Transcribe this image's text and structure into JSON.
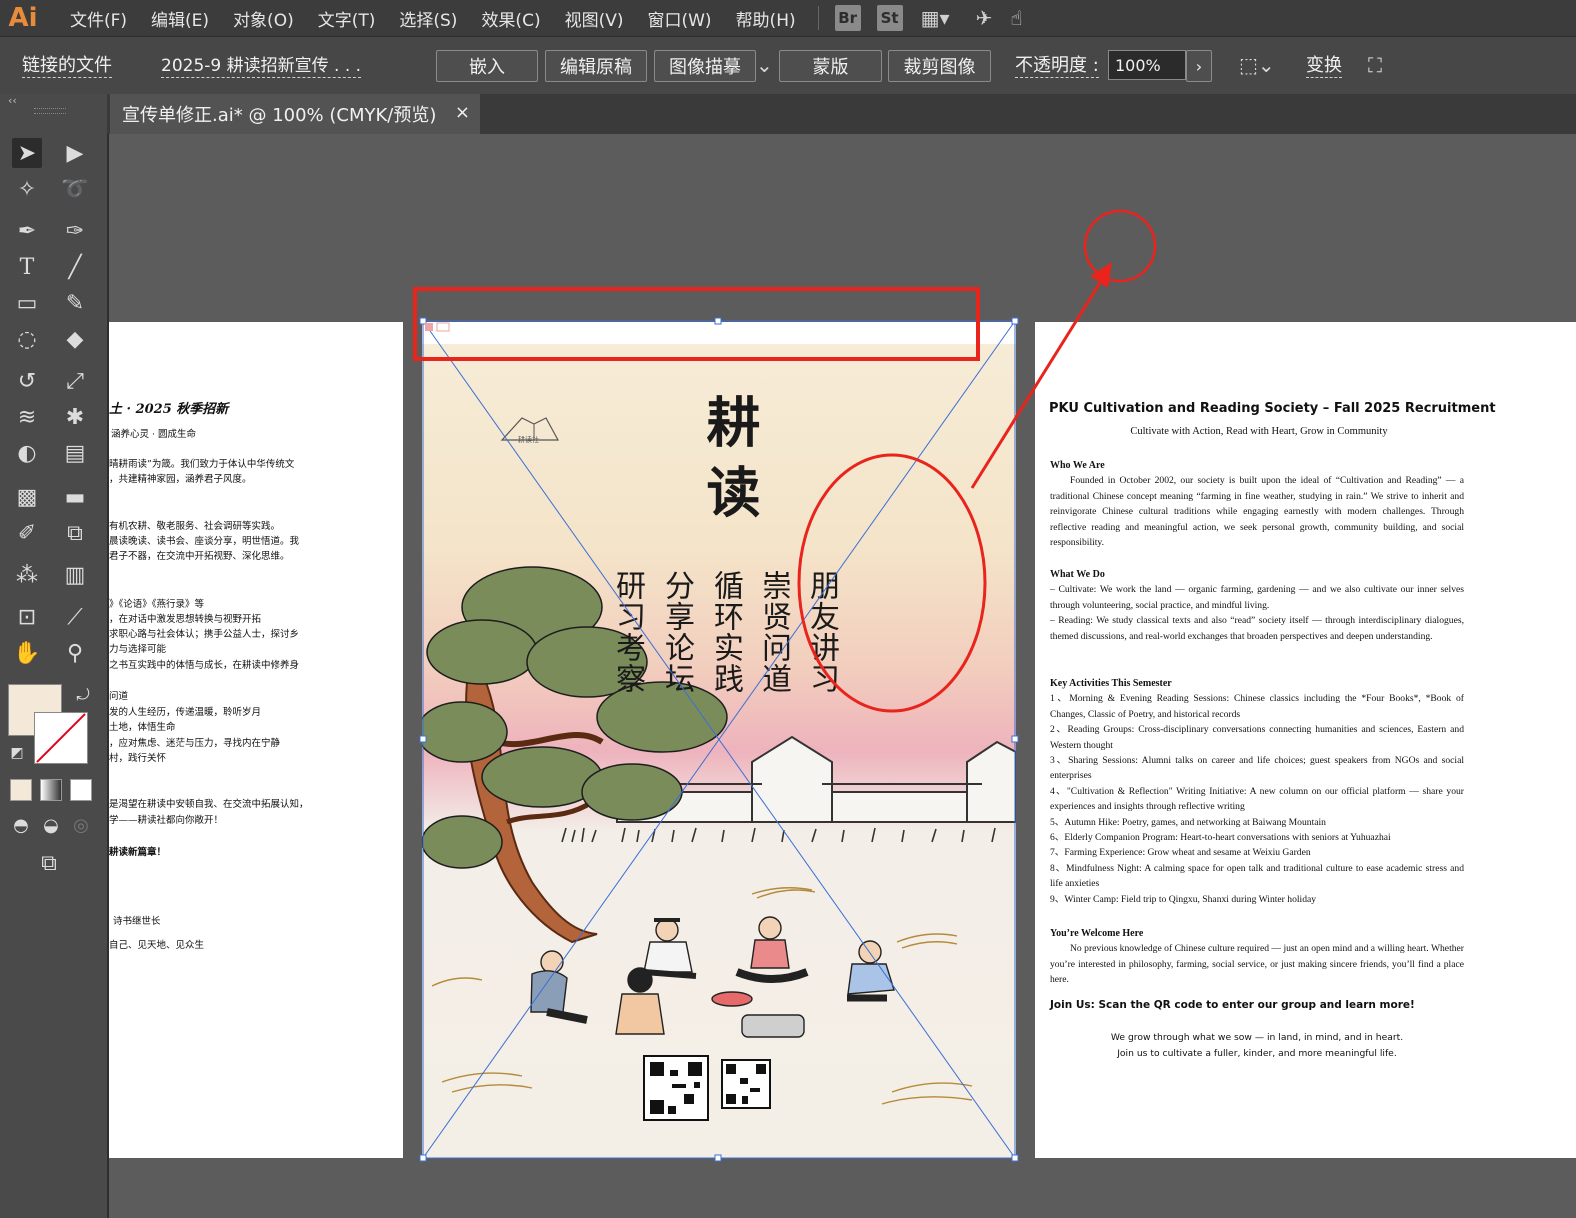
{
  "app": {
    "logo": "Ai"
  },
  "menu": {
    "items": [
      "文件(F)",
      "编辑(E)",
      "对象(O)",
      "文字(T)",
      "选择(S)",
      "效果(C)",
      "视图(V)",
      "窗口(W)",
      "帮助(H)"
    ],
    "bridge": "Br",
    "stock": "St"
  },
  "control_bar": {
    "linked_file_label": "链接的文件",
    "file_name": "2025-9 耕读招新宣传 . . .",
    "embed": "嵌入",
    "edit_original": "编辑原稿",
    "image_trace": "图像描摹",
    "mask": "蒙版",
    "crop_image": "裁剪图像",
    "opacity_label": "不透明度 :",
    "opacity_value": "100%",
    "transform": "变换"
  },
  "document_tab": {
    "title": "宣传单修正.ai* @ 100% (CMYK/预览)",
    "close": "×"
  },
  "poster": {
    "title_chars": [
      "耕",
      "读"
    ],
    "columns": [
      "朋友讲习",
      "崇贤问道",
      "循环实践",
      "分享论坛",
      "研习考察"
    ],
    "logo_text": "耕读社"
  },
  "left_doc": {
    "lines": [
      "土 · 2025 秋季招新",
      "涵养心灵 · 圆成生命",
      "晴耕雨读”为箴。我们致力于体认中华传统文",
      "，共建精神家园，涵养君子风度。",
      "有机农耕、敬老服务、社会调研等实践。",
      "晨读晚读、读书会、座谈分享，明世悟道。我",
      "君子不器，在交流中开拓视野、深化思维。",
      "》《论语》《燕行录》等",
      "，在对话中激发思想转换与视野开拓",
      "求职心路与社会体认；携手公益人士，探讨乡",
      "力与选择可能",
      "之书互实践中的体悟与成长，在耕读中修养身",
      "问道",
      "发的人生经历，传递温暖，聆听岁月",
      "土地，体悟生命",
      "，应对焦虑、迷茫与压力，寻找内在宁静",
      "村，践行关怀",
      "是渴望在耕读中安顿自我、在交流中拓展认知，",
      "学——耕读社都向你敞开！",
      "耕读新篇章！",
      "诗书继世长",
      "自己、见天地、见众生"
    ]
  },
  "right_doc": {
    "title": "PKU Cultivation and Reading Society – Fall 2025 Recruitment",
    "subtitle": "Cultivate with Action, Read with Heart, Grow in Community",
    "who_head": "Who We Are",
    "who_body": "Founded in October 2002, our society is built upon the ideal of “Cultivation and Reading” — a traditional Chinese concept meaning “farming in fine weather, studying in rain.” We strive to inherit and reinvigorate Chinese cultural traditions while engaging earnestly with modern challenges. Through reflective reading and meaningful action, we seek personal growth, community building, and social responsibility.",
    "what_head": "What We Do",
    "what_1": "– Cultivate: We work the land — organic farming, gardening — and we also cultivate our inner selves through volunteering, social practice, and mindful living.",
    "what_2": "– Reading: We study classical texts and also “read” society itself — through interdisciplinary dialogues, themed discussions, and real-world exchanges that broaden perspectives and deepen understanding.",
    "key_head": "Key Activities This Semester",
    "activities": [
      "1、Morning & Evening Reading Sessions: Chinese classics including the *Four Books*, *Book of Changes, Classic of Poetry, and historical records",
      "2、Reading Groups: Cross-disciplinary conversations connecting humanities and sciences, Eastern and Western thought",
      "3、Sharing Sessions: Alumni talks on career and life choices; guest speakers from NGOs and social enterprises",
      "4、\"Cultivation & Reflection\" Writing Initiative: A new column on our official platform — share your experiences and insights through reflective writing",
      "5、Autumn Hike: Poetry, games, and networking at Baiwang Mountain",
      "6、Elderly Companion Program: Heart-to-heart conversations with seniors at Yuhuazhai",
      "7、Farming Experience: Grow wheat and sesame at Weixiu Garden",
      "8、Mindfulness Night: A calming space for open talk and traditional culture to ease academic stress and life anxieties",
      "9、Winter Camp: Field trip to Qingxu, Shanxi during Winter holiday"
    ],
    "welcome_head": "You’re Welcome Here",
    "welcome_body": "No previous knowledge of Chinese culture required — just an open mind and a willing heart. Whether you’re interested in philosophy, farming, social service, or just making sincere friends, you’ll find a place here.",
    "join": "Join Us: Scan the QR code to enter our group and learn more!",
    "closing_1": "We grow through what we sow — in land, in mind, and in heart.",
    "closing_2": "Join us to cultivate a fuller, kinder, and more meaningful life."
  },
  "colors": {
    "annotation_red": "#e8241c",
    "selection_blue": "#3b6fd6",
    "fill_swatch": "#f4e9d8"
  }
}
